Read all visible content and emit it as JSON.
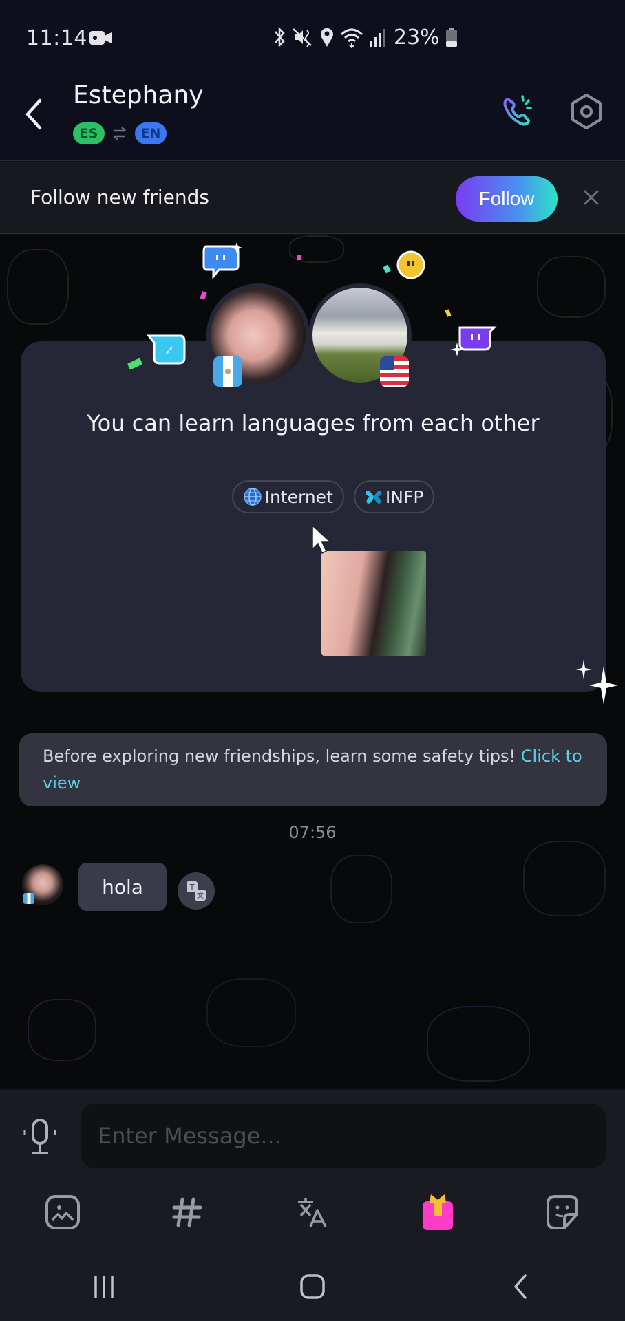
{
  "status_bar": {
    "time": "11:14",
    "battery_percent": "23%",
    "icons": [
      "video-camera-icon",
      "bluetooth-icon",
      "mute-vibrate-icon",
      "location-icon",
      "wifi-icon",
      "signal-icon",
      "battery-icon"
    ]
  },
  "header": {
    "contact_name": "Estephany",
    "native_language": "ES",
    "learning_language": "EN",
    "native_color": "#2bbf66",
    "learning_color": "#3b78f0",
    "icons": [
      "back-icon",
      "swap-icon",
      "voice-call-icon",
      "settings-icon"
    ]
  },
  "follow_bar": {
    "text": "Follow new friends",
    "button_label": "Follow",
    "close_icon": "close-icon"
  },
  "intro_card": {
    "title": "You can learn languages from each other",
    "tags": [
      {
        "icon": "globe-icon",
        "label": "Internet"
      },
      {
        "icon": "butterfly-icon",
        "label": "INFP"
      }
    ],
    "user_a_flag": "Guatemala",
    "user_b_flag": "United States"
  },
  "safety_notice": {
    "text": "Before exploring new friendships, learn some safety tips! ",
    "link": "Click to view"
  },
  "messages": [
    {
      "timestamp": "07:56",
      "sender": "Estephany",
      "text": "hola",
      "flag": "Guatemala"
    }
  ],
  "composer": {
    "placeholder": "Enter Message...",
    "value": ""
  },
  "toolbar": {
    "items": [
      "image-icon",
      "hashtag-icon",
      "translate-icon",
      "gift-icon",
      "sticker-icon"
    ],
    "accent_color": "#ff3cc8"
  },
  "navbar": {
    "items": [
      "recent-apps-icon",
      "home-icon",
      "back-icon"
    ]
  }
}
